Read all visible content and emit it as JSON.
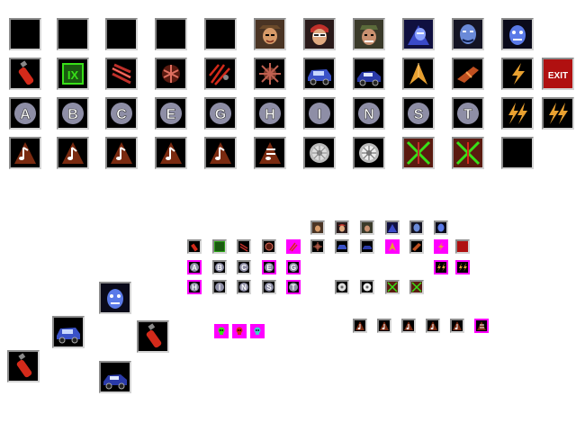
{
  "sheet": {
    "row1": [
      "empty",
      "empty",
      "empty",
      "empty",
      "empty",
      "portrait-cowboy",
      "portrait-shades",
      "portrait-bandana",
      "portrait-blue-1",
      "portrait-blue-2",
      "portrait-blue-3"
    ],
    "row2": [
      "extinguisher",
      "ix-box",
      "claw",
      "shield",
      "scratch",
      "spike-ball",
      "car-blue-1",
      "car-blue-2",
      "arrow",
      "jet",
      "lightning"
    ],
    "row2_exit": "EXIT",
    "row3_letters": [
      "A",
      "B",
      "C",
      "E",
      "G",
      "H",
      "I",
      "N",
      "S",
      "T"
    ],
    "row4": [
      "note-1",
      "note-2",
      "note-3",
      "note-4",
      "note-5",
      "note-6",
      "wheel-1",
      "wheel-2",
      "x-box-1",
      "x-box-2",
      "empty"
    ]
  },
  "small": {
    "letters_row1": [
      "A",
      "B",
      "C",
      "E",
      "G"
    ],
    "letters_row2": [
      "H",
      "I",
      "N",
      "S",
      "T"
    ]
  },
  "colors": {
    "tile_bg": "#000000",
    "frame": "#8c8c8c",
    "magenta": "#ff00ff",
    "red": "#d42a1a",
    "green": "#38e018",
    "gold": "#e8a030",
    "letter_disc": "#8e8ea6"
  }
}
